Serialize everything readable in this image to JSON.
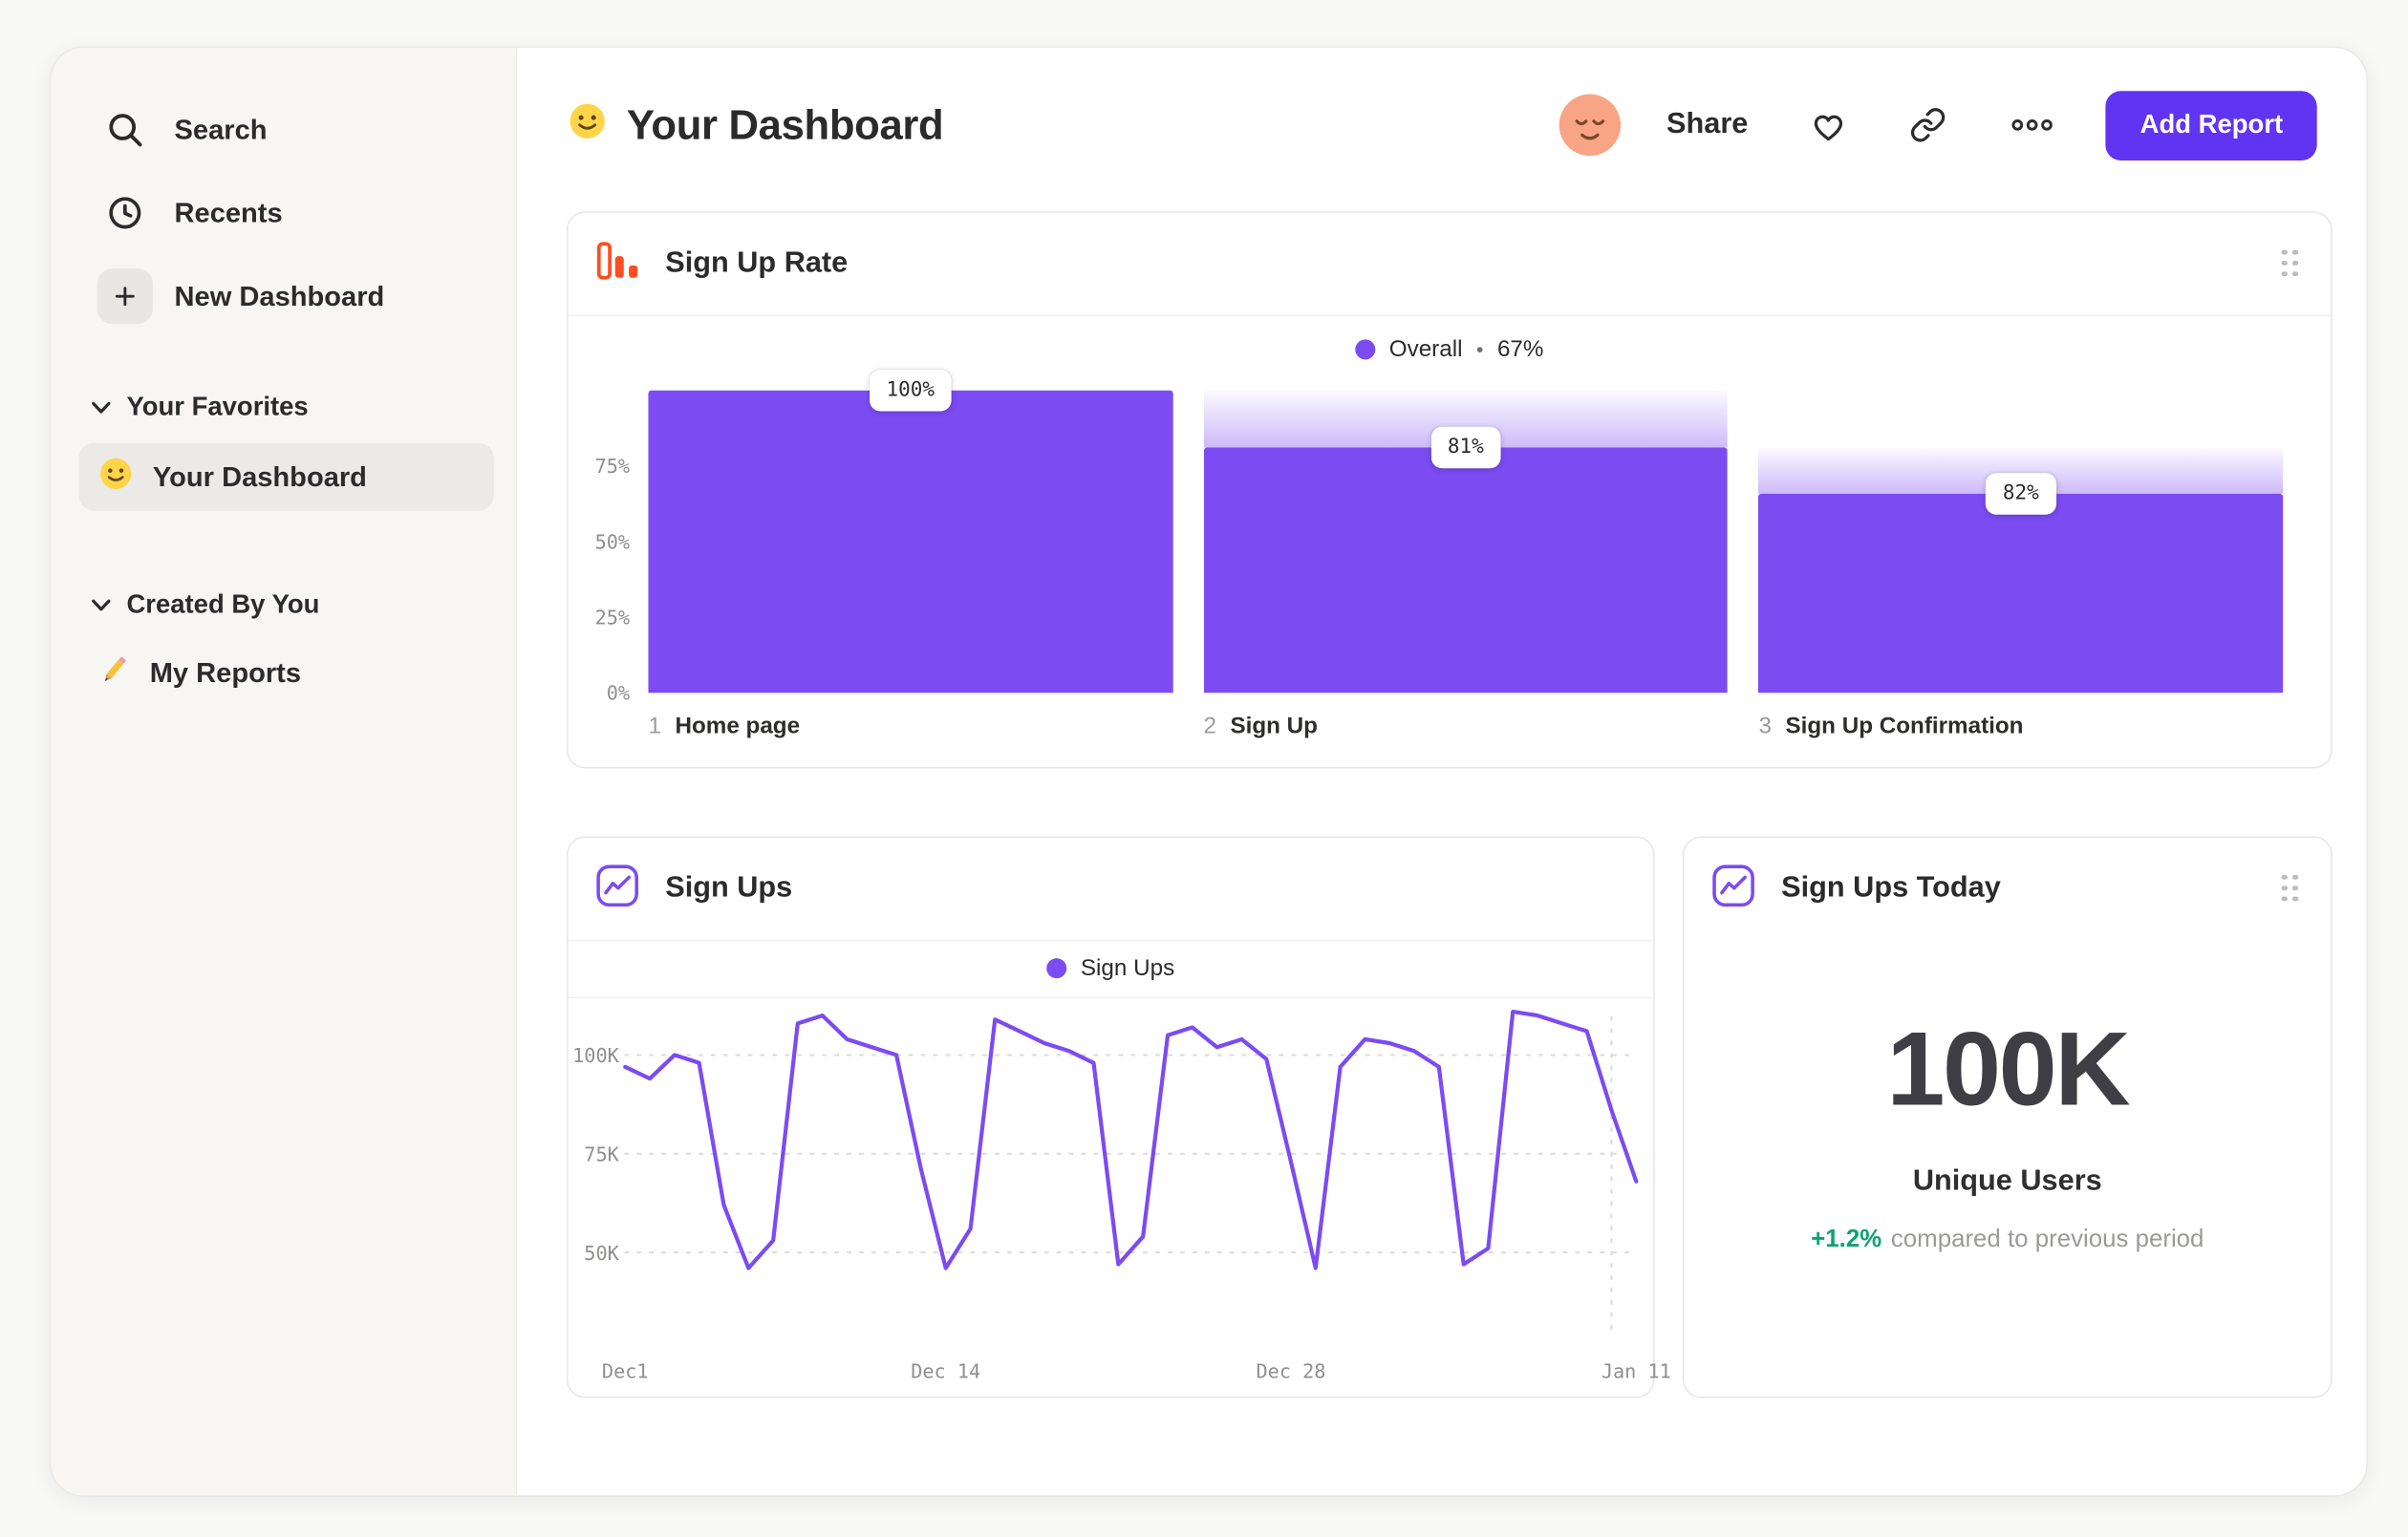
{
  "colors": {
    "accent_purple": "#7c4bf2",
    "button_purple": "#6134f3",
    "orange_icon": "#fd4e22",
    "green_delta": "#0ea371",
    "sidebar_bg": "#f7f6f3"
  },
  "icons": {
    "search": "magnifier",
    "recents": "clock",
    "new_dashboard": "plus",
    "section_chevron": "chevron-down",
    "favorite_emoji": "slightly-smiling-face",
    "reports_emoji": "pencil",
    "header_emoji": "slightly-smiling-face",
    "avatar": "relieved-face",
    "favorite_action": "heart",
    "copy_link": "link",
    "more": "ellipsis",
    "funnel_card": "orange-bar-chart",
    "line_card": "purple-line-chart",
    "big_card": "purple-line-chart",
    "drag": "drag-handle"
  },
  "sidebar": {
    "search": "Search",
    "recents": "Recents",
    "new_dashboard": "New Dashboard",
    "favorites_header": "Your Favorites",
    "favorite_item": "Your Dashboard",
    "created_header": "Created By You",
    "reports_item": "My Reports"
  },
  "header": {
    "title": "Your Dashboard",
    "share": "Share",
    "add_report": "Add Report"
  },
  "chart_data": [
    {
      "id": "sign-up-rate",
      "type": "bar",
      "title": "Sign Up Rate",
      "legend": {
        "name": "Overall",
        "sep": "•",
        "value": "67%"
      },
      "steps": [
        {
          "num": "1",
          "name": "Home page",
          "value": 100,
          "prev": 100,
          "label": "100%"
        },
        {
          "num": "2",
          "name": "Sign Up",
          "value": 81,
          "prev": 100,
          "label": "81%"
        },
        {
          "num": "3",
          "name": "Sign Up Confirmation",
          "value": 66,
          "prev": 81,
          "label": "82%"
        }
      ],
      "yticks": [
        {
          "label": "75%",
          "value": 75
        },
        {
          "label": "50%",
          "value": 50
        },
        {
          "label": "25%",
          "value": 25
        },
        {
          "label": "0%",
          "value": 0
        }
      ],
      "ylim": [
        0,
        100
      ],
      "bar_color": "#7c4bf2",
      "legend_position": "top-center",
      "grid": false
    },
    {
      "id": "sign-ups",
      "type": "line",
      "title": "Sign Ups",
      "legend": {
        "name": "Sign Ups"
      },
      "values": [
        97,
        94,
        100,
        98,
        62,
        46,
        53,
        108,
        110,
        104,
        102,
        100,
        71,
        46,
        56,
        109,
        106,
        103,
        101,
        98,
        47,
        54,
        105,
        107,
        102,
        104,
        99,
        73,
        46,
        97,
        104,
        103,
        101,
        97,
        47,
        51,
        111,
        110,
        108,
        106,
        86,
        68
      ],
      "yticks": [
        {
          "label": "100K",
          "value": 100
        },
        {
          "label": "75K",
          "value": 75
        },
        {
          "label": "50K",
          "value": 50
        }
      ],
      "xticks": [
        {
          "label": "Dec1",
          "index": 0
        },
        {
          "label": "Dec 14",
          "index": 13
        },
        {
          "label": "Dec 28",
          "index": 27
        },
        {
          "label": "Jan 11",
          "index": 41
        }
      ],
      "ylim": [
        26,
        112
      ],
      "marker_index": 40,
      "line_color": "#7c4bf2",
      "grid": "dashed-horizontal",
      "legend_position": "top-center"
    },
    {
      "id": "sign-ups-today",
      "type": "big_number",
      "title": "Sign Ups Today",
      "value": "100K",
      "label": "Unique Users",
      "delta": "+1.2%",
      "note": "compared to previous period",
      "delta_color": "#0ea371"
    }
  ]
}
